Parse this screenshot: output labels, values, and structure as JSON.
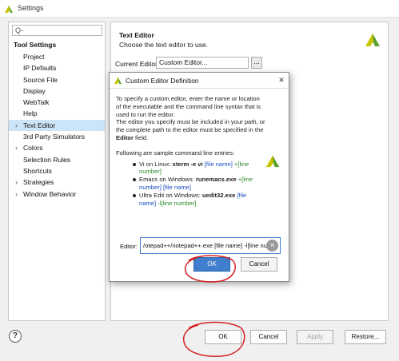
{
  "window": {
    "title": "Settings",
    "icon": "app-logo-icon"
  },
  "sidebar": {
    "search_placeholder": "Q-",
    "root_label": "Tool Settings",
    "items": [
      {
        "label": "Project",
        "expandable": false
      },
      {
        "label": "IP Defaults",
        "expandable": false
      },
      {
        "label": "Source File",
        "expandable": false
      },
      {
        "label": "Display",
        "expandable": false
      },
      {
        "label": "WebTalk",
        "expandable": false
      },
      {
        "label": "Help",
        "expandable": false
      },
      {
        "label": "Text Editor",
        "expandable": true,
        "selected": true
      },
      {
        "label": "3rd Party Simulators",
        "expandable": false
      },
      {
        "label": "Colors",
        "expandable": true
      },
      {
        "label": "Selection Rules",
        "expandable": false
      },
      {
        "label": "Shortcuts",
        "expandable": false
      },
      {
        "label": "Strategies",
        "expandable": true
      },
      {
        "label": "Window Behavior",
        "expandable": true
      }
    ]
  },
  "main": {
    "title": "Text Editor",
    "description": "Choose the text editor to use.",
    "current_editor_label": "Current Editor:",
    "current_editor_value": "Custom Editor...",
    "browse_label": "..."
  },
  "dialog": {
    "title": "Custom Editor Definition",
    "close_glyph": "×",
    "intro_1": "To specify a custom editor, enter the name or location",
    "intro_2": "of the executable and the command line syntax that is",
    "intro_3": "used to run the editor.",
    "intro_4": "The editor you specify must be included in your path, or",
    "intro_5": "the complete path to the editor must be specified in the",
    "intro_6_bold": "Editor",
    "intro_6_rest": " field.",
    "examples_heading": "Following are sample command line entries:",
    "examples": [
      {
        "prefix": "Vi on Linux: ",
        "cmd": "xterm -e vi",
        "arg1": " [file name]",
        "arg2": " +[line",
        "cont_blue": "",
        "cont_green": "number]"
      },
      {
        "prefix": "Emacs on Windows: ",
        "cmd": "runemacs.exe",
        "arg1": "",
        "arg2": " +[line",
        "cont_blue": "number] [file name]",
        "cont_green": ""
      },
      {
        "prefix": "Ultra Edit on Windows: ",
        "cmd": "uedit32.exe",
        "arg1": " [file",
        "arg2": "",
        "cont_blue": "name]",
        "cont_green": " -l[line number]"
      }
    ],
    "editor_label": "Editor:",
    "editor_value": "/otepad++/notepad++.exe [file name] -l[line num",
    "ok_label": "OK",
    "cancel_label": "Cancel"
  },
  "footer": {
    "help_label": "?",
    "ok_label": "OK",
    "cancel_label": "Cancel",
    "apply_label": "Apply",
    "restore_label": "Restore..."
  },
  "colors": {
    "accent": "#3f7fce",
    "selection": "#cce4f7",
    "brand_yellow": "#c8c400",
    "brand_green": "#5aa02c",
    "annotation_red": "#d42020"
  }
}
